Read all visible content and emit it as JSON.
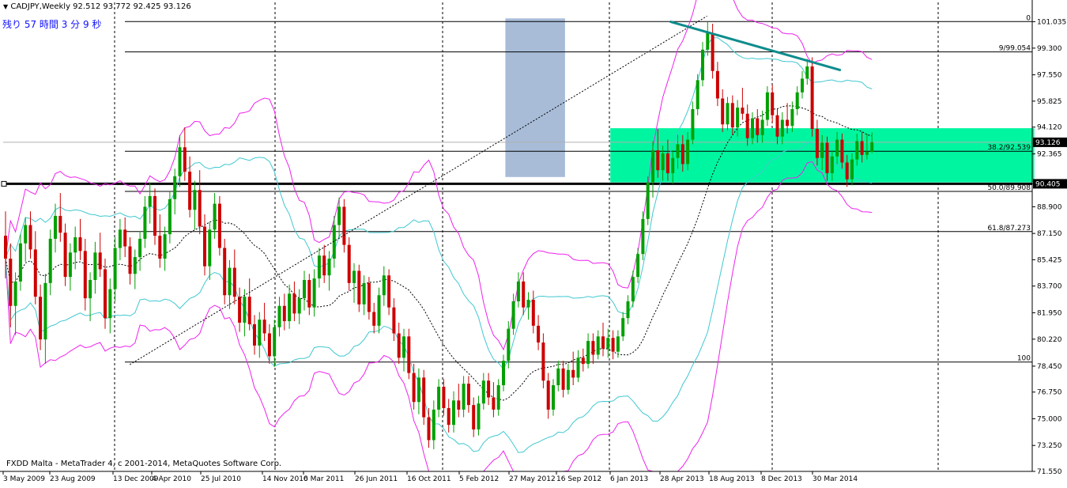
{
  "header": {
    "symbol_line": "CADJPY,Weekly  92.512 93.772 92.425 93.126",
    "countdown": "残り 57 時間 3 分 9 秒",
    "menu_icon": "triangle-down-icon"
  },
  "footer": {
    "copyright": "FXDD Malta - MetaTrader 4, c 2001-2014, MetaQuotes Software Corp."
  },
  "colors": {
    "background": "#ffffff",
    "bull_candle": "#00a000",
    "bear_candle": "#cc0000",
    "bollinger_outer": "#ee22ee",
    "bollinger_inner": "#40c8d0",
    "ma_dashed": "#000000",
    "zone_green": "#00f5a0",
    "zone_blue": "#a8bcd8",
    "trendline": "#0e8c8c",
    "price_label_bg": "#000000",
    "price_label_text": "#ffffff"
  },
  "chart_data": {
    "type": "candlestick",
    "symbol": "CADJPY",
    "timeframe": "Weekly",
    "current": {
      "open": 92.512,
      "high": 93.772,
      "low": 92.425,
      "close": 93.126
    },
    "ylim": [
      71.55,
      102.3
    ],
    "y_ticks": [
      "101.035",
      "99.300",
      "97.550",
      "95.825",
      "94.120",
      "92.365",
      "90.405",
      "88.900",
      "87.150",
      "85.425",
      "83.700",
      "81.950",
      "80.220",
      "78.450",
      "76.750",
      "75.000",
      "73.250",
      "71.550"
    ],
    "x_ticks": [
      "3 May 2009",
      "23 Aug 2009",
      "13 Dec 2009",
      "4 Apr 2010",
      "25 Jul 2010",
      "14 Nov 2010",
      "6 Mar 2011",
      "26 Jun 2011",
      "16 Oct 2011",
      "5 Feb 2012",
      "27 May 2012",
      "16 Sep 2012",
      "6 Jan 2013",
      "28 Apr 2013",
      "18 Aug 2013",
      "8 Dec 2013",
      "30 Mar 2014"
    ],
    "fibonacci": [
      {
        "label": "0",
        "value": 101.04
      },
      {
        "label": "9/99.054",
        "value": 99.054
      },
      {
        "label": "38.2/92.539",
        "value": 92.539
      },
      {
        "label": "50.0/89.908",
        "value": 89.908
      },
      {
        "label": "61.8/87.273",
        "value": 87.273
      },
      {
        "label": "100",
        "value": 78.72
      }
    ],
    "horizontal_line": {
      "value": 90.405,
      "label": "90.405"
    },
    "current_price_label": "93.126",
    "zones": [
      {
        "name": "blue-zone",
        "x0": 48.8,
        "x1": 54.6,
        "y0": 90.85,
        "y1": 101.25
      },
      {
        "name": "green-zone",
        "x0": 59.0,
        "x1": 100.2,
        "y0": 90.5,
        "y1": 94.05
      }
    ],
    "trendlines": [
      {
        "name": "dotted-diagonal",
        "style": "dotted",
        "x0": 12.3,
        "y0": 78.55,
        "x1": 68.4,
        "y1": 101.4
      },
      {
        "name": "resistance",
        "style": "solid",
        "x0": 64.8,
        "y0": 101.04,
        "x1": 81.4,
        "y1": 97.85
      }
    ],
    "ohlc": [
      [
        87.0,
        88.6,
        84.2,
        85.5
      ],
      [
        85.5,
        86.5,
        81.0,
        82.4
      ],
      [
        82.4,
        84.6,
        80.5,
        84.0
      ],
      [
        84.0,
        87.1,
        83.4,
        86.5
      ],
      [
        86.5,
        88.2,
        85.3,
        87.7
      ],
      [
        87.7,
        88.6,
        85.5,
        86.1
      ],
      [
        86.1,
        87.3,
        82.5,
        83.0
      ],
      [
        83.0,
        83.8,
        79.5,
        80.2
      ],
      [
        80.2,
        84.5,
        78.6,
        83.9
      ],
      [
        83.9,
        87.4,
        83.1,
        86.8
      ],
      [
        86.8,
        89.1,
        85.9,
        88.3
      ],
      [
        88.3,
        89.8,
        86.6,
        87.2
      ],
      [
        87.2,
        87.8,
        83.7,
        84.3
      ],
      [
        84.3,
        86.5,
        83.4,
        85.9
      ],
      [
        85.9,
        87.6,
        84.8,
        86.9
      ],
      [
        86.9,
        88.1,
        85.4,
        86.0
      ],
      [
        86.0,
        86.8,
        82.1,
        82.9
      ],
      [
        82.9,
        84.6,
        81.4,
        84.1
      ],
      [
        84.1,
        86.6,
        83.2,
        85.9
      ],
      [
        85.9,
        87.2,
        84.3,
        84.8
      ],
      [
        84.8,
        85.5,
        80.9,
        81.6
      ],
      [
        81.6,
        84.2,
        80.6,
        83.5
      ],
      [
        83.5,
        86.9,
        82.7,
        86.2
      ],
      [
        86.2,
        88.1,
        85.4,
        87.4
      ],
      [
        87.4,
        88.2,
        85.6,
        86.3
      ],
      [
        86.3,
        86.9,
        83.8,
        84.5
      ],
      [
        84.5,
        86.1,
        83.5,
        85.6
      ],
      [
        85.6,
        87.3,
        84.7,
        86.8
      ],
      [
        86.8,
        89.6,
        86.2,
        88.9
      ],
      [
        88.9,
        90.5,
        87.8,
        89.6
      ],
      [
        89.6,
        90.1,
        86.4,
        87.0
      ],
      [
        87.0,
        88.4,
        84.9,
        85.5
      ],
      [
        85.5,
        87.6,
        84.7,
        87.1
      ],
      [
        87.1,
        89.9,
        86.5,
        89.4
      ],
      [
        89.4,
        91.4,
        88.4,
        90.9
      ],
      [
        90.9,
        93.6,
        90.2,
        92.8
      ],
      [
        92.8,
        94.1,
        90.6,
        91.2
      ],
      [
        91.2,
        92.2,
        88.2,
        88.7
      ],
      [
        88.7,
        90.6,
        87.4,
        90.0
      ],
      [
        90.0,
        91.3,
        87.1,
        87.6
      ],
      [
        87.6,
        88.4,
        84.4,
        85.0
      ],
      [
        85.0,
        87.9,
        84.1,
        87.4
      ],
      [
        87.4,
        89.8,
        86.8,
        89.1
      ],
      [
        89.1,
        89.6,
        85.7,
        86.2
      ],
      [
        86.2,
        86.8,
        82.5,
        83.1
      ],
      [
        83.1,
        85.4,
        82.2,
        84.9
      ],
      [
        84.9,
        86.1,
        82.5,
        83.0
      ],
      [
        83.0,
        83.6,
        80.7,
        81.3
      ],
      [
        81.3,
        83.5,
        80.4,
        83.0
      ],
      [
        83.0,
        84.2,
        80.8,
        81.2
      ],
      [
        81.2,
        81.8,
        79.2,
        79.8
      ],
      [
        79.8,
        82.0,
        79.0,
        81.5
      ],
      [
        81.5,
        82.6,
        80.1,
        80.6
      ],
      [
        80.6,
        81.2,
        78.6,
        79.1
      ],
      [
        79.1,
        81.5,
        78.4,
        81.0
      ],
      [
        81.0,
        83.0,
        80.4,
        82.4
      ],
      [
        82.4,
        83.2,
        80.8,
        81.4
      ],
      [
        81.4,
        83.8,
        80.9,
        83.2
      ],
      [
        83.2,
        84.0,
        81.4,
        81.9
      ],
      [
        81.9,
        83.5,
        81.2,
        82.9
      ],
      [
        82.9,
        84.7,
        82.1,
        84.1
      ],
      [
        84.1,
        84.5,
        81.8,
        82.3
      ],
      [
        82.3,
        84.8,
        81.7,
        84.2
      ],
      [
        84.2,
        86.2,
        83.6,
        85.7
      ],
      [
        85.7,
        86.4,
        83.9,
        84.4
      ],
      [
        84.4,
        86.0,
        83.4,
        85.5
      ],
      [
        85.5,
        88.3,
        84.9,
        87.7
      ],
      [
        87.7,
        89.5,
        86.8,
        88.9
      ],
      [
        88.9,
        89.4,
        85.9,
        86.4
      ],
      [
        86.4,
        86.9,
        83.4,
        83.9
      ],
      [
        83.9,
        85.2,
        82.6,
        84.7
      ],
      [
        84.7,
        85.1,
        82.0,
        82.5
      ],
      [
        82.5,
        84.4,
        81.8,
        83.9
      ],
      [
        83.9,
        84.3,
        81.5,
        82.0
      ],
      [
        82.0,
        82.6,
        80.6,
        81.1
      ],
      [
        81.1,
        83.6,
        80.6,
        83.1
      ],
      [
        83.1,
        85.0,
        82.4,
        84.4
      ],
      [
        84.4,
        84.8,
        81.8,
        82.3
      ],
      [
        82.3,
        82.9,
        80.1,
        80.6
      ],
      [
        80.6,
        81.3,
        78.6,
        79.0
      ],
      [
        79.0,
        80.9,
        78.1,
        80.4
      ],
      [
        80.4,
        80.9,
        77.6,
        78.0
      ],
      [
        78.0,
        78.6,
        75.6,
        76.1
      ],
      [
        76.1,
        78.3,
        75.3,
        77.7
      ],
      [
        77.7,
        78.2,
        74.6,
        75.1
      ],
      [
        75.1,
        75.7,
        73.1,
        73.6
      ],
      [
        73.6,
        76.2,
        73.0,
        75.6
      ],
      [
        75.6,
        77.6,
        75.1,
        77.1
      ],
      [
        77.1,
        77.6,
        75.2,
        75.7
      ],
      [
        75.7,
        76.3,
        74.1,
        74.6
      ],
      [
        74.6,
        76.8,
        74.1,
        76.2
      ],
      [
        76.2,
        77.3,
        75.1,
        75.6
      ],
      [
        75.6,
        77.8,
        75.1,
        77.3
      ],
      [
        77.3,
        77.8,
        75.4,
        75.9
      ],
      [
        75.9,
        76.4,
        73.8,
        74.3
      ],
      [
        74.3,
        76.5,
        73.9,
        76.0
      ],
      [
        76.0,
        78.0,
        75.6,
        77.5
      ],
      [
        77.5,
        78.0,
        75.9,
        76.4
      ],
      [
        76.4,
        77.4,
        75.1,
        75.6
      ],
      [
        75.6,
        77.6,
        75.2,
        77.2
      ],
      [
        77.2,
        79.2,
        76.8,
        78.8
      ],
      [
        78.8,
        81.4,
        78.3,
        80.9
      ],
      [
        80.9,
        83.2,
        80.5,
        82.7
      ],
      [
        82.7,
        84.6,
        82.3,
        84.0
      ],
      [
        84.0,
        84.6,
        81.8,
        82.3
      ],
      [
        82.3,
        83.3,
        81.5,
        82.8
      ],
      [
        82.8,
        83.4,
        80.6,
        81.1
      ],
      [
        81.1,
        81.8,
        79.5,
        80.0
      ],
      [
        80.0,
        80.6,
        77.0,
        77.5
      ],
      [
        77.5,
        78.0,
        75.0,
        75.6
      ],
      [
        75.6,
        77.6,
        75.2,
        77.2
      ],
      [
        77.2,
        78.8,
        76.8,
        78.3
      ],
      [
        78.3,
        78.8,
        76.4,
        76.9
      ],
      [
        76.9,
        78.6,
        76.6,
        78.2
      ],
      [
        78.2,
        79.4,
        77.2,
        77.7
      ],
      [
        77.7,
        79.5,
        77.4,
        79.0
      ],
      [
        79.0,
        79.6,
        78.1,
        78.6
      ],
      [
        78.6,
        80.6,
        78.3,
        80.1
      ],
      [
        80.1,
        80.6,
        78.6,
        79.2
      ],
      [
        79.2,
        80.8,
        78.9,
        80.4
      ],
      [
        80.4,
        81.3,
        79.1,
        79.6
      ],
      [
        79.6,
        80.9,
        79.0,
        80.3
      ],
      [
        80.3,
        80.8,
        78.9,
        79.4
      ],
      [
        79.4,
        80.8,
        79.0,
        80.4
      ],
      [
        80.4,
        82.0,
        80.1,
        81.6
      ],
      [
        81.6,
        83.1,
        81.2,
        82.7
      ],
      [
        82.7,
        84.7,
        82.3,
        84.3
      ],
      [
        84.3,
        86.2,
        83.9,
        85.8
      ],
      [
        85.8,
        88.6,
        85.4,
        88.1
      ],
      [
        88.1,
        90.9,
        87.7,
        90.5
      ],
      [
        90.5,
        93.2,
        89.5,
        92.6
      ],
      [
        92.6,
        94.0,
        90.8,
        91.3
      ],
      [
        91.3,
        92.9,
        90.6,
        92.4
      ],
      [
        92.4,
        93.3,
        90.6,
        91.1
      ],
      [
        91.1,
        92.6,
        90.4,
        92.1
      ],
      [
        92.1,
        93.6,
        91.4,
        93.0
      ],
      [
        93.0,
        93.6,
        91.2,
        91.7
      ],
      [
        91.7,
        93.8,
        91.3,
        93.3
      ],
      [
        93.3,
        95.8,
        93.0,
        95.3
      ],
      [
        95.3,
        97.6,
        94.9,
        97.2
      ],
      [
        97.2,
        99.7,
        96.8,
        99.2
      ],
      [
        99.2,
        101.0,
        98.8,
        100.3
      ],
      [
        100.3,
        100.9,
        97.3,
        97.8
      ],
      [
        97.8,
        98.4,
        95.5,
        96.0
      ],
      [
        96.0,
        96.6,
        93.8,
        94.3
      ],
      [
        94.3,
        96.1,
        93.9,
        95.7
      ],
      [
        95.7,
        96.2,
        93.6,
        94.1
      ],
      [
        94.1,
        95.9,
        93.5,
        95.4
      ],
      [
        95.4,
        96.7,
        94.6,
        95.0
      ],
      [
        95.0,
        95.6,
        92.9,
        93.4
      ],
      [
        93.4,
        95.1,
        93.0,
        94.7
      ],
      [
        94.7,
        95.3,
        93.1,
        93.6
      ],
      [
        93.6,
        95.2,
        93.1,
        94.6
      ],
      [
        94.6,
        96.8,
        94.2,
        96.4
      ],
      [
        96.4,
        96.9,
        94.4,
        94.9
      ],
      [
        94.9,
        95.3,
        93.0,
        93.5
      ],
      [
        93.5,
        95.1,
        93.0,
        94.6
      ],
      [
        94.6,
        95.7,
        93.7,
        94.2
      ],
      [
        94.2,
        95.8,
        93.8,
        95.3
      ],
      [
        95.3,
        96.8,
        94.9,
        96.4
      ],
      [
        96.4,
        97.8,
        96.0,
        97.3
      ],
      [
        97.3,
        98.6,
        96.9,
        98.1
      ],
      [
        98.1,
        98.7,
        93.5,
        94.0
      ],
      [
        94.0,
        94.6,
        91.6,
        92.1
      ],
      [
        92.1,
        93.6,
        91.3,
        93.1
      ],
      [
        93.1,
        93.5,
        90.6,
        91.1
      ],
      [
        91.1,
        92.6,
        90.6,
        92.2
      ],
      [
        92.2,
        93.8,
        91.7,
        93.3
      ],
      [
        93.3,
        93.7,
        91.4,
        91.8
      ],
      [
        91.8,
        92.3,
        90.2,
        90.7
      ],
      [
        90.7,
        92.4,
        90.3,
        92.0
      ],
      [
        92.0,
        93.7,
        91.6,
        93.2
      ],
      [
        93.2,
        93.8,
        91.8,
        92.3
      ],
      [
        92.3,
        93.7,
        92.0,
        92.5
      ],
      [
        92.5,
        93.77,
        92.42,
        93.13
      ]
    ]
  }
}
